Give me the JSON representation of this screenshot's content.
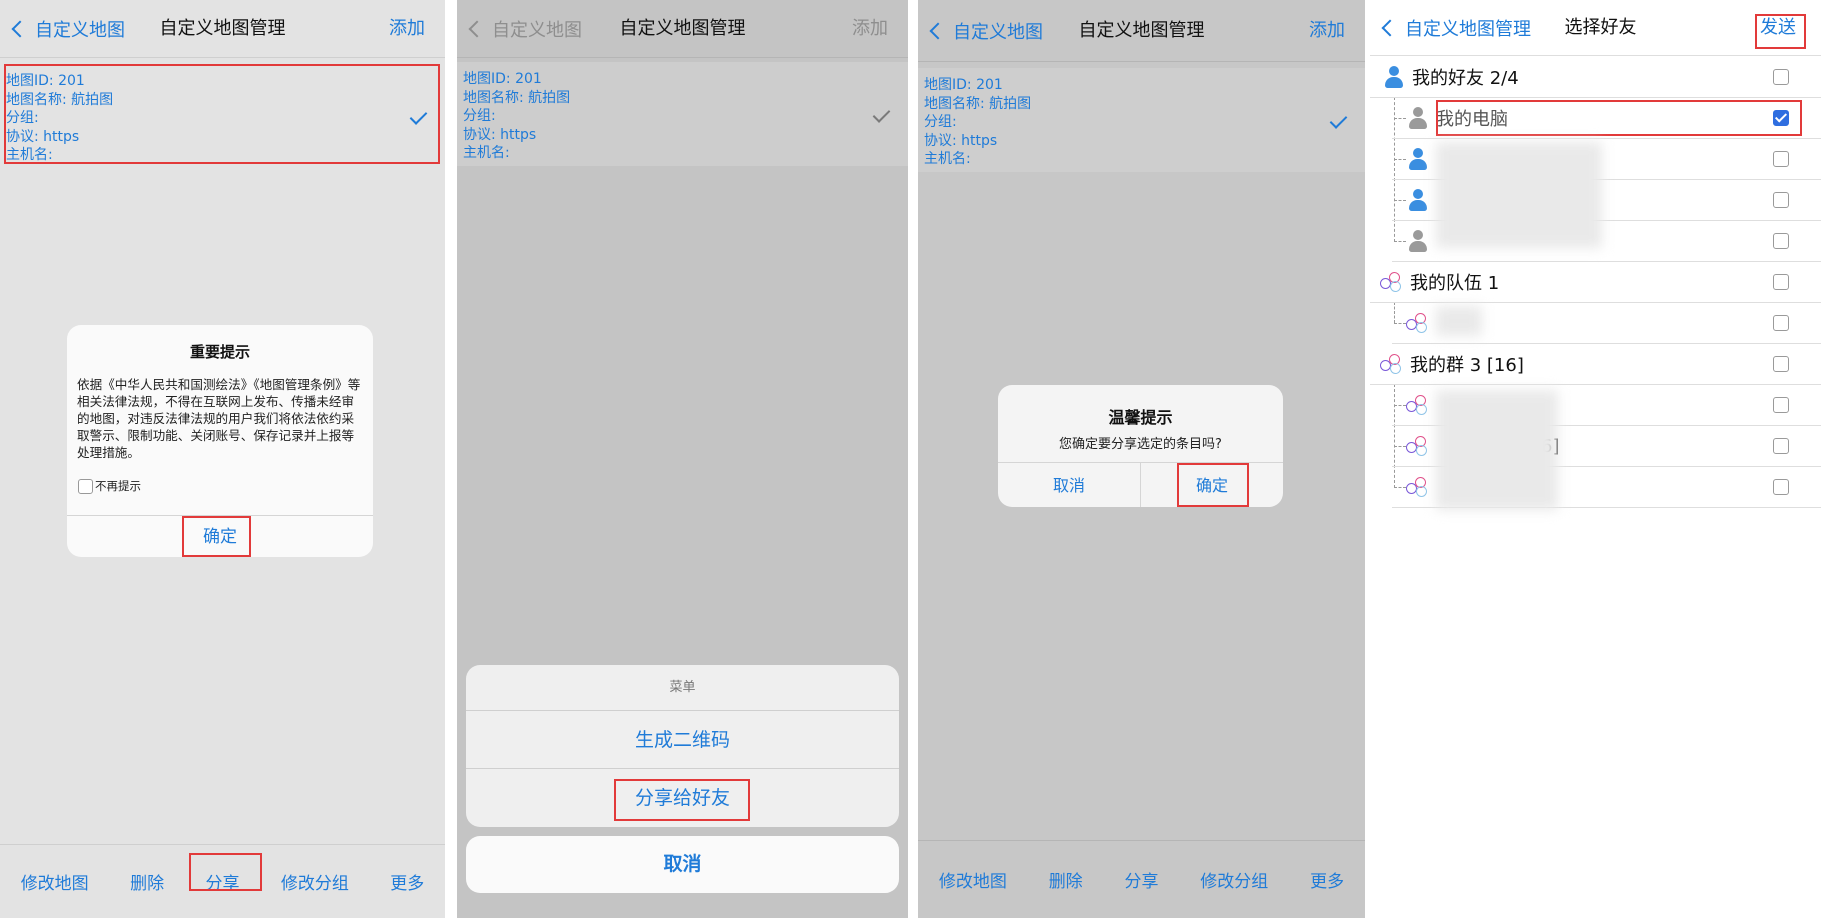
{
  "panel1": {
    "nav": {
      "back": "自定义地图",
      "title": "自定义地图管理",
      "right": "添加"
    },
    "item": {
      "id": "地图ID: 201",
      "name": "地图名称: 航拍图",
      "group": "分组:",
      "protocol": "协议: https",
      "host": "主机名:"
    },
    "dialog": {
      "title": "重要提示",
      "body": "依据《中华人民共和国测绘法》《地图管理条例》等相关法律法规，不得在互联网上发布、传播未经审的地图，对违反法律法规的用户我们将依法依约采取警示、限制功能、关闭账号、保存记录并上报等处理措施。",
      "checkbox": "不再提示",
      "confirm": "确定"
    },
    "toolbar": [
      "修改地图",
      "删除",
      "分享",
      "修改分组",
      "更多"
    ]
  },
  "panel2": {
    "nav": {
      "back": "自定义地图",
      "title": "自定义地图管理",
      "right": "添加"
    },
    "item": {
      "id": "地图ID: 201",
      "name": "地图名称: 航拍图",
      "group": "分组:",
      "protocol": "协议: https",
      "host": "主机名:"
    },
    "sheet": {
      "title": "菜单",
      "qrcode": "生成二维码",
      "share": "分享给好友",
      "cancel": "取消"
    }
  },
  "panel3": {
    "nav": {
      "back": "自定义地图",
      "title": "自定义地图管理",
      "right": "添加"
    },
    "item": {
      "id": "地图ID: 201",
      "name": "地图名称: 航拍图",
      "group": "分组:",
      "protocol": "协议: https",
      "host": "主机名:"
    },
    "dialog": {
      "title": "温馨提示",
      "message": "您确定要分享选定的条目吗?",
      "cancel": "取消",
      "confirm": "确定"
    },
    "toolbar": [
      "修改地图",
      "删除",
      "分享",
      "修改分组",
      "更多"
    ]
  },
  "panel4": {
    "nav": {
      "back": "自定义地图管理",
      "title": "选择好友",
      "right": "发送"
    },
    "friends_group": "我的好友 2/4",
    "my_computer": "我的电脑",
    "team_group": "我的队伍 1",
    "chat_group": "我的群 3 [16]",
    "partial_text": "6]"
  },
  "colors": {
    "accent": "#1f7bd8",
    "highlight": "#e23a3a",
    "checkbox_on": "#2f6ee0"
  }
}
